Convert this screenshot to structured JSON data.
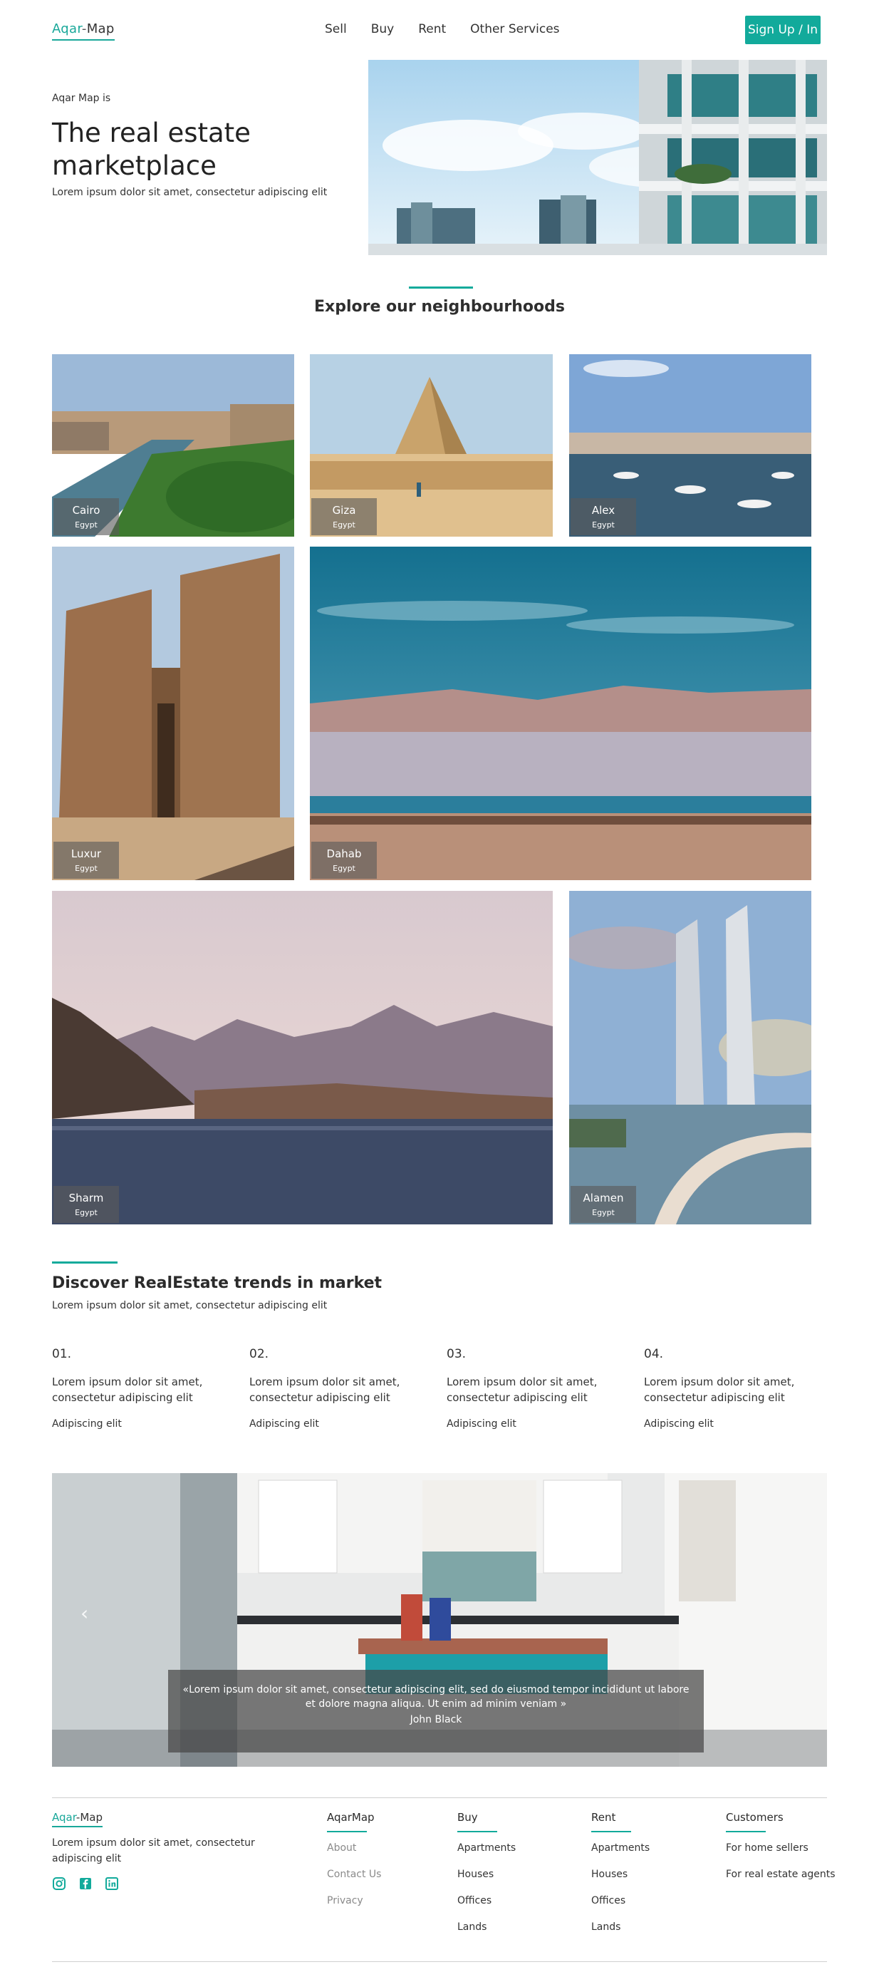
{
  "header": {
    "logo_aqar": "Aqar",
    "logo_dash": "-",
    "logo_map": "Map",
    "nav": [
      "Sell",
      "Buy",
      "Rent",
      "Other Services"
    ],
    "signup_label": "Sign Up / In"
  },
  "hero": {
    "eyebrow": "Aqar Map is",
    "title": "The real estate marketplace",
    "subtitle": "Lorem ipsum dolor sit amet, consectetur adipiscing elit"
  },
  "neighbourhoods": {
    "title": "Explore our neighbourhoods",
    "cards": [
      {
        "city": "Cairo",
        "country": "Egypt"
      },
      {
        "city": "Giza",
        "country": "Egypt"
      },
      {
        "city": "Alex",
        "country": "Egypt"
      },
      {
        "city": "Luxur",
        "country": "Egypt"
      },
      {
        "city": "Dahab",
        "country": "Egypt"
      },
      {
        "city": "Sharm",
        "country": "Egypt"
      },
      {
        "city": "Alamen",
        "country": "Egypt"
      }
    ]
  },
  "trends": {
    "title": "Discover RealEstate trends in market",
    "subtitle": "Lorem ipsum dolor sit amet, consectetur adipiscing elit",
    "items": [
      {
        "num": "01.",
        "text": "Lorem ipsum dolor sit amet, consectetur adipiscing elit",
        "foot": "Adipiscing elit"
      },
      {
        "num": "02.",
        "text": "Lorem ipsum dolor sit amet, consectetur adipiscing elit",
        "foot": "Adipiscing elit"
      },
      {
        "num": "03.",
        "text": "Lorem ipsum dolor sit amet, consectetur adipiscing elit",
        "foot": "Adipiscing elit"
      },
      {
        "num": "04.",
        "text": "Lorem ipsum dolor sit amet, consectetur adipiscing elit",
        "foot": "Adipiscing elit"
      }
    ]
  },
  "testimonial": {
    "quote": "«Lorem ipsum dolor sit amet, consectetur adipiscing elit, sed do eiusmod tempor incididunt ut labore et dolore magna aliqua. Ut enim ad minim veniam »",
    "author": "John Black"
  },
  "footer": {
    "logo_aqar": "Aqar",
    "logo_map": "-Map",
    "description": "Lorem ipsum dolor sit amet, consectetur adipiscing elit",
    "socials": [
      "instagram-icon",
      "facebook-icon",
      "linkedin-icon"
    ],
    "columns": [
      {
        "heading": "AqarMap",
        "links": [
          "About",
          "Contact Us",
          "Privacy"
        ]
      },
      {
        "heading": "Buy",
        "links": [
          "Apartments",
          "Houses",
          "Offices",
          "Lands"
        ]
      },
      {
        "heading": "Rent",
        "links": [
          "Apartments",
          "Houses",
          "Offices",
          "Lands"
        ]
      },
      {
        "heading": "Customers",
        "links": [
          "For home sellers",
          "For real estate agents"
        ]
      }
    ]
  },
  "colors": {
    "accent": "#12aa9b",
    "text": "#2b2b2b"
  }
}
